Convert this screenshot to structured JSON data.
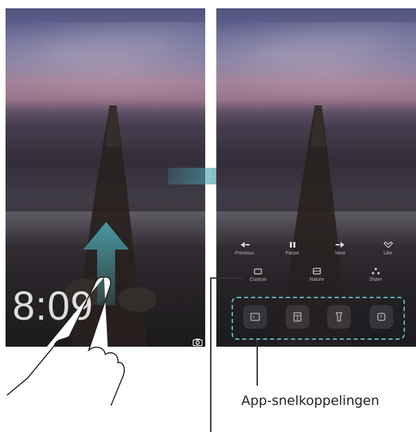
{
  "left_screen": {
    "clock": "8:09"
  },
  "right_screen": {
    "controls_row1": [
      {
        "label": "Previous",
        "icon": "previous-icon"
      },
      {
        "label": "Pause",
        "icon": "pause-icon"
      },
      {
        "label": "Next",
        "icon": "next-icon"
      },
      {
        "label": "Like",
        "icon": "heart-icon"
      }
    ],
    "controls_row2": [
      {
        "label": "Custom",
        "icon": "custom-icon"
      },
      {
        "label": "Nature",
        "icon": "nature-icon"
      },
      {
        "label": "Share",
        "icon": "share-icon"
      }
    ],
    "app_shortcuts": [
      {
        "icon": "recorder-icon"
      },
      {
        "icon": "calculator-icon"
      },
      {
        "icon": "flashlight-icon"
      },
      {
        "icon": "timer-icon"
      }
    ]
  },
  "callout": {
    "label": "App-snelkoppelingen"
  },
  "colors": {
    "arrow": "#4a9fa8",
    "dashed_outline": "#5fb8c2",
    "callout_line": "#333333"
  }
}
